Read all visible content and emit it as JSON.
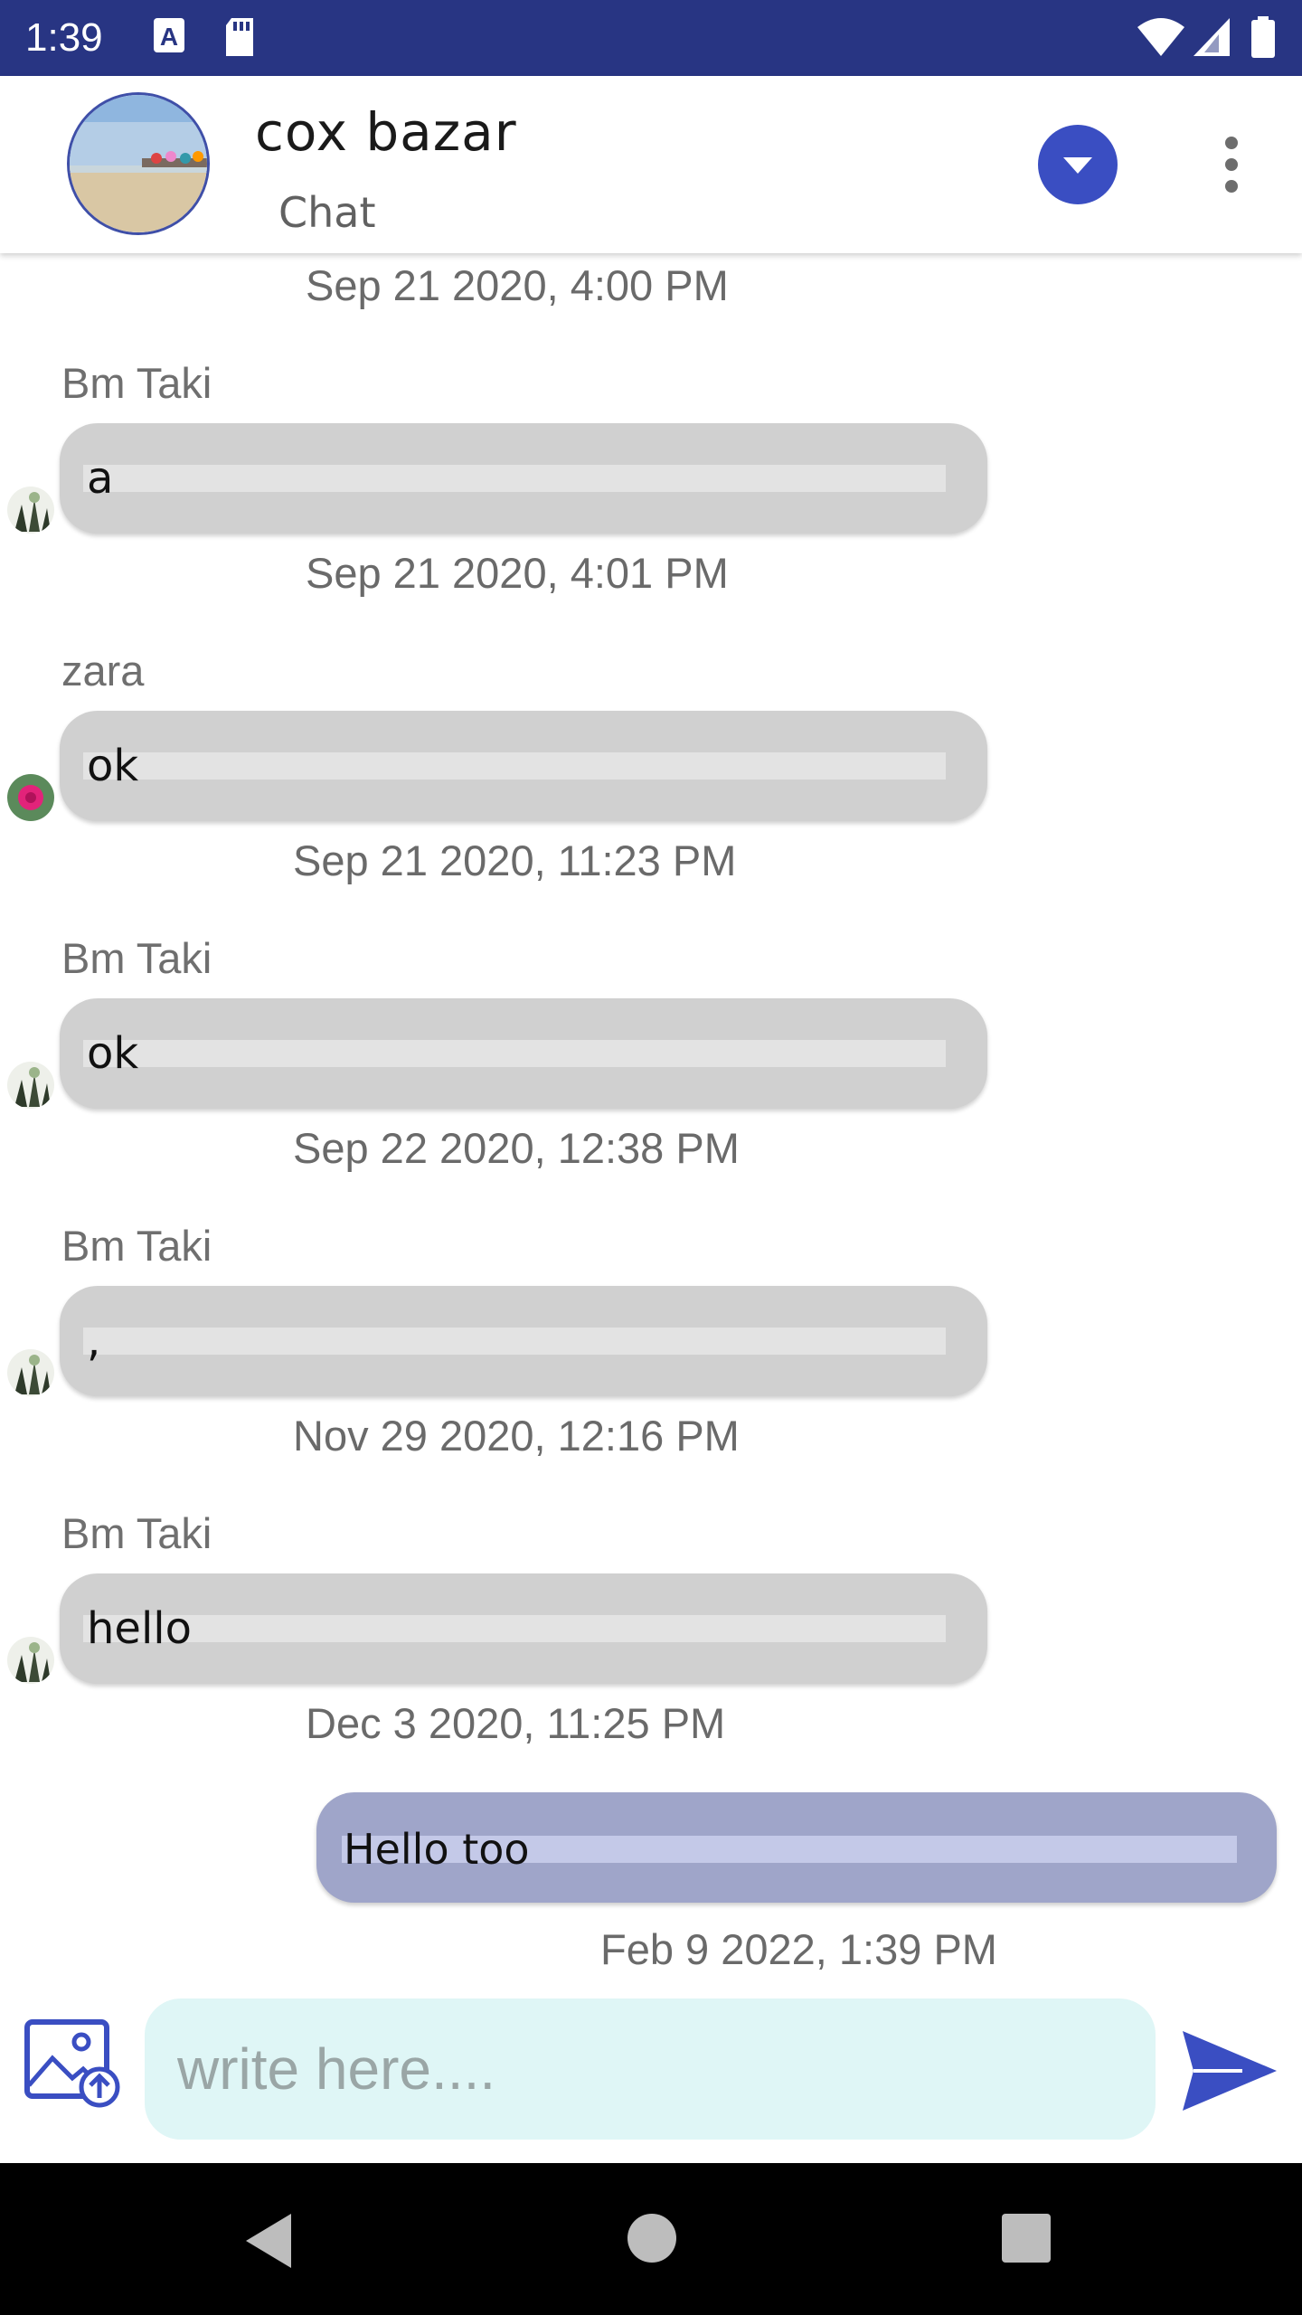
{
  "status_bar": {
    "time": "1:39",
    "icons": [
      "text-notification-icon",
      "sd-card-icon",
      "wifi-icon",
      "signal-icon",
      "battery-icon"
    ]
  },
  "header": {
    "title": "cox bazar",
    "subtitle": "Chat",
    "avatar": "beach-photo-avatar",
    "dropdown_icon": "chevron-down-icon",
    "menu_icon": "more-vert-icon"
  },
  "messages": [
    {
      "kind": "timestamp",
      "text": "Sep 21 2020, 4:00 PM"
    },
    {
      "kind": "incoming",
      "sender": "Bm Taki",
      "text": "a",
      "avatar": "bmtaki-avatar"
    },
    {
      "kind": "timestamp",
      "text": "Sep 21 2020, 4:01 PM"
    },
    {
      "kind": "incoming",
      "sender": "zara",
      "text": "ok",
      "avatar": "zara-flower-avatar"
    },
    {
      "kind": "timestamp",
      "text": "Sep 21 2020, 11:23 PM"
    },
    {
      "kind": "incoming",
      "sender": "Bm Taki",
      "text": "ok",
      "avatar": "bmtaki-avatar"
    },
    {
      "kind": "timestamp",
      "text": "Sep 22 2020, 12:38 PM"
    },
    {
      "kind": "incoming",
      "sender": "Bm Taki",
      "text": ",",
      "avatar": "bmtaki-avatar"
    },
    {
      "kind": "timestamp",
      "text": "Nov 29 2020, 12:16 PM"
    },
    {
      "kind": "incoming",
      "sender": "Bm Taki",
      "text": "hello",
      "avatar": "bmtaki-avatar"
    },
    {
      "kind": "timestamp",
      "text": "Dec 3 2020, 11:25 PM"
    },
    {
      "kind": "outgoing",
      "text": "Hello too"
    },
    {
      "kind": "timestamp",
      "text": "Feb 9 2022, 1:39 PM"
    }
  ],
  "composer": {
    "placeholder": "write here....",
    "attach_icon": "image-upload-icon",
    "send_icon": "send-icon"
  },
  "nav_bar": {
    "icons": [
      "back-icon",
      "home-icon",
      "recents-icon"
    ]
  },
  "colors": {
    "status_bar": "#283583",
    "accent": "#3a4ec2",
    "incoming_bubble": "#d0d0d0",
    "outgoing_bubble": "#9fa5c9",
    "composer_input": "#dff6f6"
  }
}
